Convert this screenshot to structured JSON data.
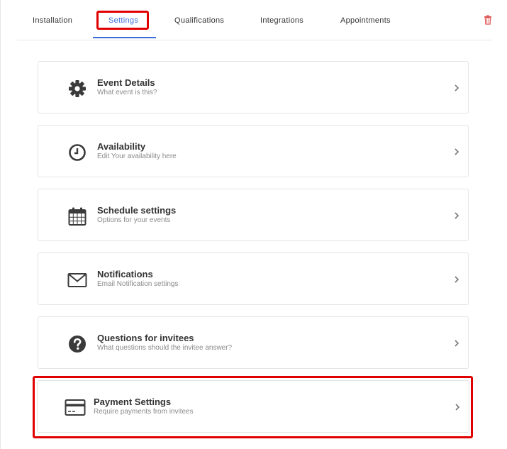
{
  "tabs": [
    {
      "label": "Installation",
      "active": false
    },
    {
      "label": "Settings",
      "active": true
    },
    {
      "label": "Qualifications",
      "active": false
    },
    {
      "label": "Integrations",
      "active": false
    },
    {
      "label": "Appointments",
      "active": false
    }
  ],
  "colors": {
    "accent": "#3b6fd6",
    "highlight": "#e00000",
    "danger": "#e05555",
    "icon": "#3a3a3a",
    "subtitle": "#8a8a8a"
  },
  "header_icons": {
    "delete": "trash-icon"
  },
  "cards": [
    {
      "icon": "gear-icon",
      "title": "Event Details",
      "subtitle": "What event is this?"
    },
    {
      "icon": "clock-icon",
      "title": "Availability",
      "subtitle": "Edit Your availability here"
    },
    {
      "icon": "calendar-icon",
      "title": "Schedule settings",
      "subtitle": "Options for your events"
    },
    {
      "icon": "envelope-icon",
      "title": "Notifications",
      "subtitle": "Email Notification settings"
    },
    {
      "icon": "question-circle-icon",
      "title": "Questions for invitees",
      "subtitle": "What questions should the invitee answer?"
    },
    {
      "icon": "credit-card-icon",
      "title": "Payment Settings",
      "subtitle": "Require payments from invitees"
    }
  ]
}
